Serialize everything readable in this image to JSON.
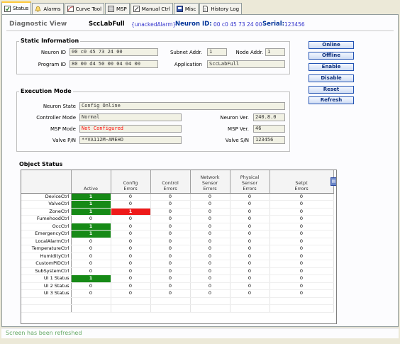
{
  "tabs": [
    {
      "label": "Status",
      "icon": "check-icon",
      "active": true
    },
    {
      "label": "Alarms",
      "icon": "bell-icon",
      "active": false
    },
    {
      "label": "Curve Tool",
      "icon": "curve-icon",
      "active": false
    },
    {
      "label": "MSP",
      "icon": "grid-icon",
      "active": false
    },
    {
      "label": "Manual Ctrl",
      "icon": "edit-icon",
      "active": false
    },
    {
      "label": "Misc",
      "icon": "misc-icon",
      "active": false
    },
    {
      "label": "History Log",
      "icon": "document-icon",
      "active": false
    }
  ],
  "header": {
    "title": "Diagnostic View",
    "device": "SccLabFull",
    "alarm": "{unackedAlarm}",
    "neuron_id_label": "Neuron ID:",
    "neuron_id_value": "00 c0 45 73 24 00",
    "serial_label": "Serial:",
    "serial_value": "123456"
  },
  "static_info": {
    "title": "Static Information",
    "neuron_id_label": "Neuron ID",
    "neuron_id": "00 c0 45 73 24 00",
    "program_id_label": "Program ID",
    "program_id": "80 00 d4 50 00 04 04 00",
    "subnet_label": "Subnet Addr.",
    "subnet": "1",
    "node_label": "Node Addr.",
    "node": "1",
    "application_label": "Application",
    "application": "SccLabFull"
  },
  "execution": {
    "title": "Execution Mode",
    "neuron_state_label": "Neuron State",
    "neuron_state": "Config Online",
    "controller_mode_label": "Controller Mode",
    "controller_mode": "Normal",
    "msp_mode_label": "MSP Mode",
    "msp_mode": "Not Configured",
    "valve_pn_label": "Valve P/N",
    "valve_pn": "**VA112M-AMEHO",
    "neuron_ver_label": "Neuron Ver.",
    "neuron_ver": "240.8.0",
    "msp_ver_label": "MSP Ver.",
    "msp_ver": "46",
    "valve_sn_label": "Valve S/N",
    "valve_sn": "123456"
  },
  "buttons": {
    "online": "Online",
    "offline": "Offline",
    "enable": "Enable",
    "disable": "Disable",
    "reset": "Reset",
    "refresh": "Refresh"
  },
  "object_status": {
    "title": "Object Status",
    "columns": [
      "Active",
      "Config\nErrors",
      "Control\nErrors",
      "Network\nSensor\nErrors",
      "Physical\nSensor\nErrors",
      "Setpt\nErrors"
    ],
    "rows": [
      {
        "name": "DeviceCtrl",
        "values": [
          "1",
          "0",
          "0",
          "0",
          "0",
          "0"
        ]
      },
      {
        "name": "ValveCtrl",
        "values": [
          "1",
          "0",
          "0",
          "0",
          "0",
          "0"
        ]
      },
      {
        "name": "ZoneCtrl",
        "values": [
          "1",
          "1",
          "0",
          "0",
          "0",
          "0"
        ]
      },
      {
        "name": "FumehoodCtrl",
        "values": [
          "0",
          "0",
          "0",
          "0",
          "0",
          "0"
        ]
      },
      {
        "name": "OccCtrl",
        "values": [
          "1",
          "0",
          "0",
          "0",
          "0",
          "0"
        ]
      },
      {
        "name": "EmergencyCtrl",
        "values": [
          "1",
          "0",
          "0",
          "0",
          "0",
          "0"
        ]
      },
      {
        "name": "LocalAlarmCtrl",
        "values": [
          "0",
          "0",
          "0",
          "0",
          "0",
          "0"
        ]
      },
      {
        "name": "TemperatureCtrl",
        "values": [
          "0",
          "0",
          "0",
          "0",
          "0",
          "0"
        ]
      },
      {
        "name": "HumidityCtrl",
        "values": [
          "0",
          "0",
          "0",
          "0",
          "0",
          "0"
        ]
      },
      {
        "name": "CustomPIDCtrl",
        "values": [
          "0",
          "0",
          "0",
          "0",
          "0",
          "0"
        ]
      },
      {
        "name": "SubSystemCtrl",
        "values": [
          "0",
          "0",
          "0",
          "0",
          "0",
          "0"
        ]
      },
      {
        "name": "UI 1 Status",
        "values": [
          "1",
          "0",
          "0",
          "0",
          "0",
          "0"
        ]
      },
      {
        "name": "UI 2 Status",
        "values": [
          "0",
          "0",
          "0",
          "0",
          "0",
          "0"
        ]
      },
      {
        "name": "UI 3 Status",
        "values": [
          "0",
          "0",
          "0",
          "0",
          "0",
          "0"
        ]
      }
    ],
    "corner_icon": "column-chooser-icon"
  },
  "status_bar": "Screen has been refreshed",
  "colors": {
    "active_green": "#168a16",
    "error_red": "#ee1a1a",
    "accent_blue": "#3333cc"
  }
}
